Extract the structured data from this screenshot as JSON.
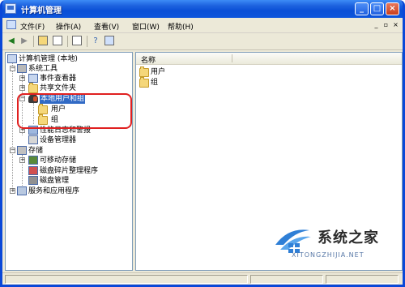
{
  "window": {
    "title": "计算机管理"
  },
  "menu": {
    "file": "文件(F)",
    "action": "操作(A)",
    "view": "查看(V)",
    "window": "窗口(W)",
    "help": "帮助(H)"
  },
  "tree": {
    "root": "计算机管理 (本地)",
    "system_tools": "系统工具",
    "event_viewer": "事件查看器",
    "shared_folders": "共享文件夹",
    "local_users_groups": "本地用户和组",
    "users": "用户",
    "groups": "组",
    "perf_logs": "性能日志和警报",
    "device_manager": "设备管理器",
    "storage": "存储",
    "removable_storage": "可移动存储",
    "defrag": "磁盘碎片整理程序",
    "disk_mgmt": "磁盘管理",
    "services_apps": "服务和应用程序"
  },
  "list": {
    "column_name": "名称",
    "items": [
      "用户",
      "组"
    ]
  },
  "watermark": {
    "brand": "系统之家",
    "url": "XITONGZHIJIA.NET"
  },
  "colors": {
    "titlebar": "#0a4fd6",
    "selection": "#316ac5",
    "highlight_ring": "#e02020",
    "folder": "#f5d77a"
  }
}
